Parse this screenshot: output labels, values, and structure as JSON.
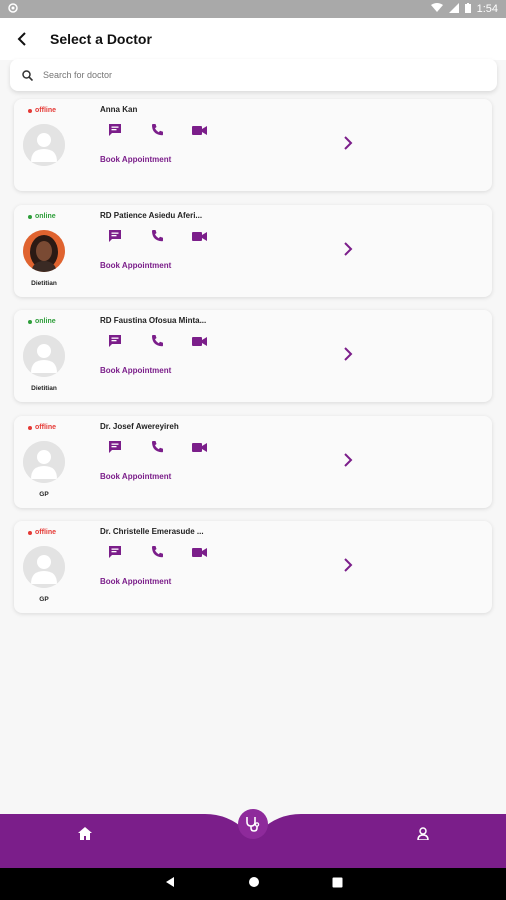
{
  "statusbar": {
    "time": "1:54"
  },
  "header": {
    "title": "Select a Doctor"
  },
  "search": {
    "placeholder": "Search for doctor"
  },
  "doctors": [
    {
      "status": "offline",
      "name": "Anna Kan",
      "role": "",
      "book_label": "Book Appointment"
    },
    {
      "status": "online",
      "name": "RD  Patience Asiedu Aferi...",
      "role": "Dietitian",
      "book_label": "Book Appointment"
    },
    {
      "status": "online",
      "name": "RD  Faustina Ofosua Minta...",
      "role": "Dietitian",
      "book_label": "Book Appointment"
    },
    {
      "status": "offline",
      "name": "Dr.  Josef Awereyireh",
      "role": "GP",
      "book_label": "Book Appointment"
    },
    {
      "status": "offline",
      "name": "Dr.  Christelle Emerasude ...",
      "role": "GP",
      "book_label": "Book Appointment"
    }
  ],
  "colors": {
    "accent": "#7b1e8a",
    "online": "#2e9e3a",
    "offline": "#e53935"
  },
  "icons": {
    "chat": "chat-icon",
    "phone": "phone-icon",
    "video": "video-icon",
    "home": "home-icon",
    "stethoscope": "stethoscope-icon",
    "profile": "profile-icon"
  }
}
